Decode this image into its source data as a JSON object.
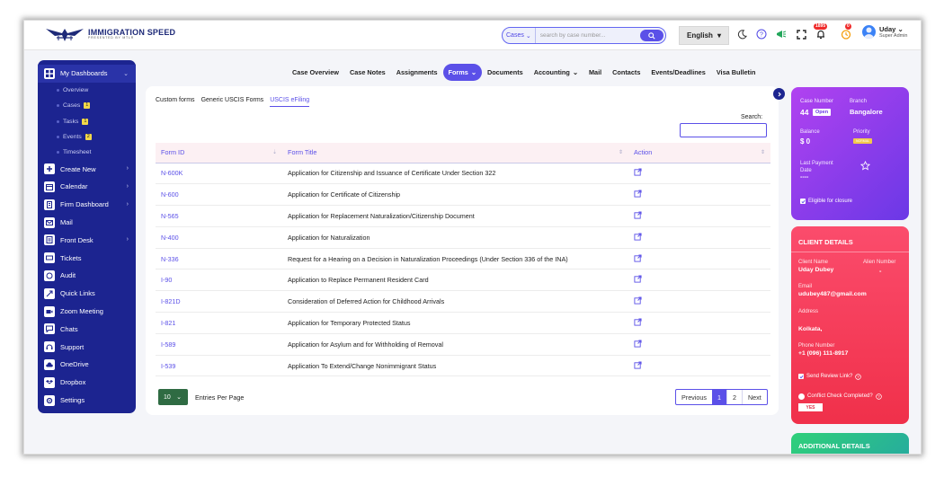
{
  "brand": {
    "name": "IMMIGRATION SPEED",
    "tagline": "PRESENTED BY MTLR"
  },
  "search": {
    "type_label": "Cases",
    "placeholder": "search by case number..."
  },
  "language": {
    "label": "English"
  },
  "notifications": {
    "count_bell": "1895",
    "count_timer": "0"
  },
  "user": {
    "name": "Uday",
    "role": "Super Admin"
  },
  "sidebar": {
    "items": [
      {
        "label": "My Dashboards",
        "icon": "dashboard-icon",
        "arrow": true
      },
      {
        "label": "Create New",
        "icon": "plus-icon",
        "arrow": true
      },
      {
        "label": "Calendar",
        "icon": "calendar-icon",
        "arrow": true
      },
      {
        "label": "Firm Dashboard",
        "icon": "building-icon",
        "arrow": true
      },
      {
        "label": "Mail",
        "icon": "mail-icon"
      },
      {
        "label": "Front Desk",
        "icon": "desk-icon",
        "arrow": true
      },
      {
        "label": "Tickets",
        "icon": "ticket-icon"
      },
      {
        "label": "Audit",
        "icon": "audit-icon"
      },
      {
        "label": "Quick Links",
        "icon": "link-icon"
      },
      {
        "label": "Zoom Meeting",
        "icon": "video-icon"
      },
      {
        "label": "Chats",
        "icon": "chat-icon"
      },
      {
        "label": "Support",
        "icon": "support-icon"
      },
      {
        "label": "OneDrive",
        "icon": "cloud-icon"
      },
      {
        "label": "Dropbox",
        "icon": "dropbox-icon"
      },
      {
        "label": "Settings",
        "icon": "gear-icon"
      }
    ],
    "subitems": [
      {
        "label": "Overview"
      },
      {
        "label": "Cases",
        "count": "1"
      },
      {
        "label": "Tasks",
        "count": "1"
      },
      {
        "label": "Events",
        "count": "2"
      },
      {
        "label": "Timesheet"
      }
    ]
  },
  "nav": {
    "tabs": [
      "Case Overview",
      "Case Notes",
      "Assignments",
      "Forms",
      "Documents",
      "Accounting",
      "Mail",
      "Contacts",
      "Events/Deadlines",
      "Visa Bulletin"
    ],
    "active": "Forms"
  },
  "forms": {
    "subtabs": [
      "Custom forms",
      "Generic USCIS Forms",
      "USCIS eFiling"
    ],
    "active_subtab": "USCIS eFiling",
    "search_label": "Search:",
    "columns": [
      "Form ID",
      "Form Title",
      "Action"
    ],
    "rows": [
      {
        "id": "N-600K",
        "title": "Application for Citizenship and Issuance of Certificate Under Section 322"
      },
      {
        "id": "N-600",
        "title": "Application for Certificate of Citizenship"
      },
      {
        "id": "N-565",
        "title": "Application for Replacement Naturalization/Citizenship Document"
      },
      {
        "id": "N-400",
        "title": "Application for Naturalization"
      },
      {
        "id": "N-336",
        "title": "Request for a Hearing on a Decision in Naturalization Proceedings (Under Section 336 of the INA)"
      },
      {
        "id": "I-90",
        "title": "Application to Replace Permanent Resident Card"
      },
      {
        "id": "I-821D",
        "title": "Consideration of Deferred Action for Childhood Arrivals"
      },
      {
        "id": "I-821",
        "title": "Application for Temporary Protected Status"
      },
      {
        "id": "I-589",
        "title": "Application for Asylum and for Withholding of Removal"
      },
      {
        "id": "I-539",
        "title": "Application To Extend/Change Nonimmigrant Status"
      }
    ],
    "per_page": "10",
    "per_page_label": "Entries Per Page",
    "pagination": {
      "previous": "Previous",
      "pages": [
        "1",
        "2"
      ],
      "current": "1",
      "next": "Next"
    }
  },
  "case_card": {
    "case_number_label": "Case Number",
    "case_number": "44",
    "status": "Open",
    "branch_label": "Branch",
    "branch": "Bangalore",
    "balance_label": "Balance",
    "balance": "$ 0",
    "priority_label": "Priority",
    "priority": "NORMAL",
    "last_payment_label": "Last Payment Date",
    "last_payment": "----",
    "eligible_label": "Eligible for closure"
  },
  "client": {
    "header": "CLIENT DETAILS",
    "name_label": "Client Name",
    "name": "Uday Dubey",
    "alien_label": "Alien Number",
    "alien": "-",
    "email_label": "Email",
    "email": "udubey487@gmail.com",
    "address_label": "Address",
    "address": "Kolkata,",
    "phone_label": "Phone Number",
    "phone": "+1 (096) 111-8917",
    "review_label": "Send Review Link?",
    "conflict_label": "Conflict Check Completed?",
    "yes_label": "YES"
  },
  "additional": {
    "header": "ADDITIONAL DETAILS"
  },
  "colors": {
    "accent": "#5b50e8",
    "sidebar": "#1c2490",
    "client": "#f0304a",
    "case": "#8b3ce9"
  }
}
